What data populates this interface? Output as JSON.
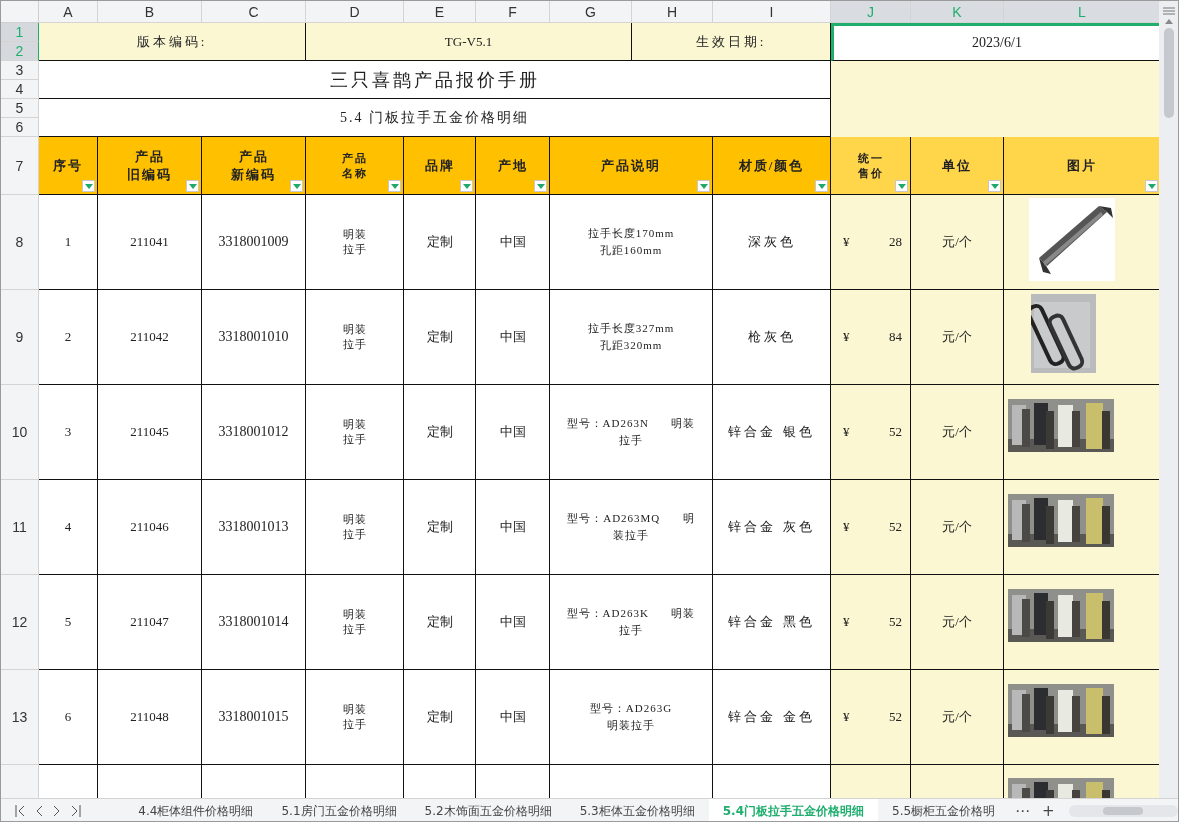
{
  "column_headers": [
    {
      "label": "A",
      "selected": false
    },
    {
      "label": "B",
      "selected": false
    },
    {
      "label": "C",
      "selected": false
    },
    {
      "label": "D",
      "selected": false
    },
    {
      "label": "E",
      "selected": false
    },
    {
      "label": "F",
      "selected": false
    },
    {
      "label": "G",
      "selected": false
    },
    {
      "label": "H",
      "selected": false
    },
    {
      "label": "I",
      "selected": false
    },
    {
      "label": "J",
      "selected": true
    },
    {
      "label": "K",
      "selected": true
    },
    {
      "label": "L",
      "selected": true
    }
  ],
  "row_headers": [
    {
      "label": "1",
      "selected": true
    },
    {
      "label": "2",
      "selected": true
    },
    {
      "label": "3",
      "selected": false
    },
    {
      "label": "4",
      "selected": false
    },
    {
      "label": "5",
      "selected": false
    },
    {
      "label": "6",
      "selected": false
    },
    {
      "label": "7",
      "selected": false
    },
    {
      "label": "8",
      "selected": false
    },
    {
      "label": "9",
      "selected": false
    },
    {
      "label": "10",
      "selected": false
    },
    {
      "label": "11",
      "selected": false
    },
    {
      "label": "12",
      "selected": false
    },
    {
      "label": "13",
      "selected": false
    }
  ],
  "info": {
    "version_label": "版本编码:",
    "version_value": "TG-V5.1",
    "date_label": "生效日期:",
    "date_value": "2023/6/1",
    "date_selected": true
  },
  "title": "三只喜鹊产品报价手册",
  "subtitle": "5.4 门板拉手五金价格明细",
  "table": {
    "columns": [
      {
        "lines": [
          "序号"
        ],
        "filter": true
      },
      {
        "lines": [
          "产品",
          "旧编码"
        ],
        "filter": true
      },
      {
        "lines": [
          "产品",
          "新编码"
        ],
        "filter": true
      },
      {
        "lines": [
          "产品",
          "名称"
        ],
        "filter": true
      },
      {
        "lines": [
          "品牌"
        ],
        "filter": true
      },
      {
        "lines": [
          "产地"
        ],
        "filter": true
      },
      {
        "lines": [
          "产品说明"
        ],
        "filter": true
      },
      {
        "lines": [
          "材质/颜色"
        ],
        "filter": true
      },
      {
        "lines": [
          "统一",
          "售价"
        ],
        "filter": true
      },
      {
        "lines": [
          "单位"
        ],
        "filter": true
      },
      {
        "lines": [
          "图片"
        ],
        "filter": true
      }
    ],
    "rows": [
      {
        "no": "1",
        "old_code": "211041",
        "new_code": "3318001009",
        "name": [
          "明装",
          "拉手"
        ],
        "brand": "定制",
        "origin": "中国",
        "description": [
          "拉手长度170mm",
          "孔距160mm"
        ],
        "material": "深灰色",
        "currency": "¥",
        "price": "28",
        "unit": "元/个"
      },
      {
        "no": "2",
        "old_code": "211042",
        "new_code": "3318001010",
        "name": [
          "明装",
          "拉手"
        ],
        "brand": "定制",
        "origin": "中国",
        "description": [
          "拉手长度327mm",
          "孔距320mm"
        ],
        "material": "枪灰色",
        "currency": "¥",
        "price": "84",
        "unit": "元/个"
      },
      {
        "no": "3",
        "old_code": "211045",
        "new_code": "3318001012",
        "name": [
          "明装",
          "拉手"
        ],
        "brand": "定制",
        "origin": "中国",
        "description": [
          "型号：AD263N      明装",
          "拉手"
        ],
        "material": "锌合金 银色",
        "currency": "¥",
        "price": "52",
        "unit": "元/个"
      },
      {
        "no": "4",
        "old_code": "211046",
        "new_code": "3318001013",
        "name": [
          "明装",
          "拉手"
        ],
        "brand": "定制",
        "origin": "中国",
        "description": [
          "型号：AD263MQ      明",
          "装拉手"
        ],
        "material": "锌合金 灰色",
        "currency": "¥",
        "price": "52",
        "unit": "元/个"
      },
      {
        "no": "5",
        "old_code": "211047",
        "new_code": "3318001014",
        "name": [
          "明装",
          "拉手"
        ],
        "brand": "定制",
        "origin": "中国",
        "description": [
          "型号：AD263K      明装",
          "拉手"
        ],
        "material": "锌合金 黑色",
        "currency": "¥",
        "price": "52",
        "unit": "元/个"
      },
      {
        "no": "6",
        "old_code": "211048",
        "new_code": "3318001015",
        "name": [
          "明装",
          "拉手"
        ],
        "brand": "定制",
        "origin": "中国",
        "description": [
          "型号：AD263G",
          "明装拉手"
        ],
        "material": "锌合金 金色",
        "currency": "¥",
        "price": "52",
        "unit": "元/个"
      }
    ]
  },
  "sheet_tabs": [
    {
      "label": "4.4柜体组件价格明细",
      "selected": false
    },
    {
      "label": "5.1房门五金价格明细",
      "selected": false
    },
    {
      "label": "5.2木饰面五金价格明细",
      "selected": false
    },
    {
      "label": "5.3柜体五金价格明细",
      "selected": false
    },
    {
      "label": "5.4门板拉手五金价格明细",
      "selected": true
    },
    {
      "label": "5.5橱柜五金价格明",
      "selected": false
    }
  ],
  "tab_more": "⋯",
  "tab_add": "+"
}
